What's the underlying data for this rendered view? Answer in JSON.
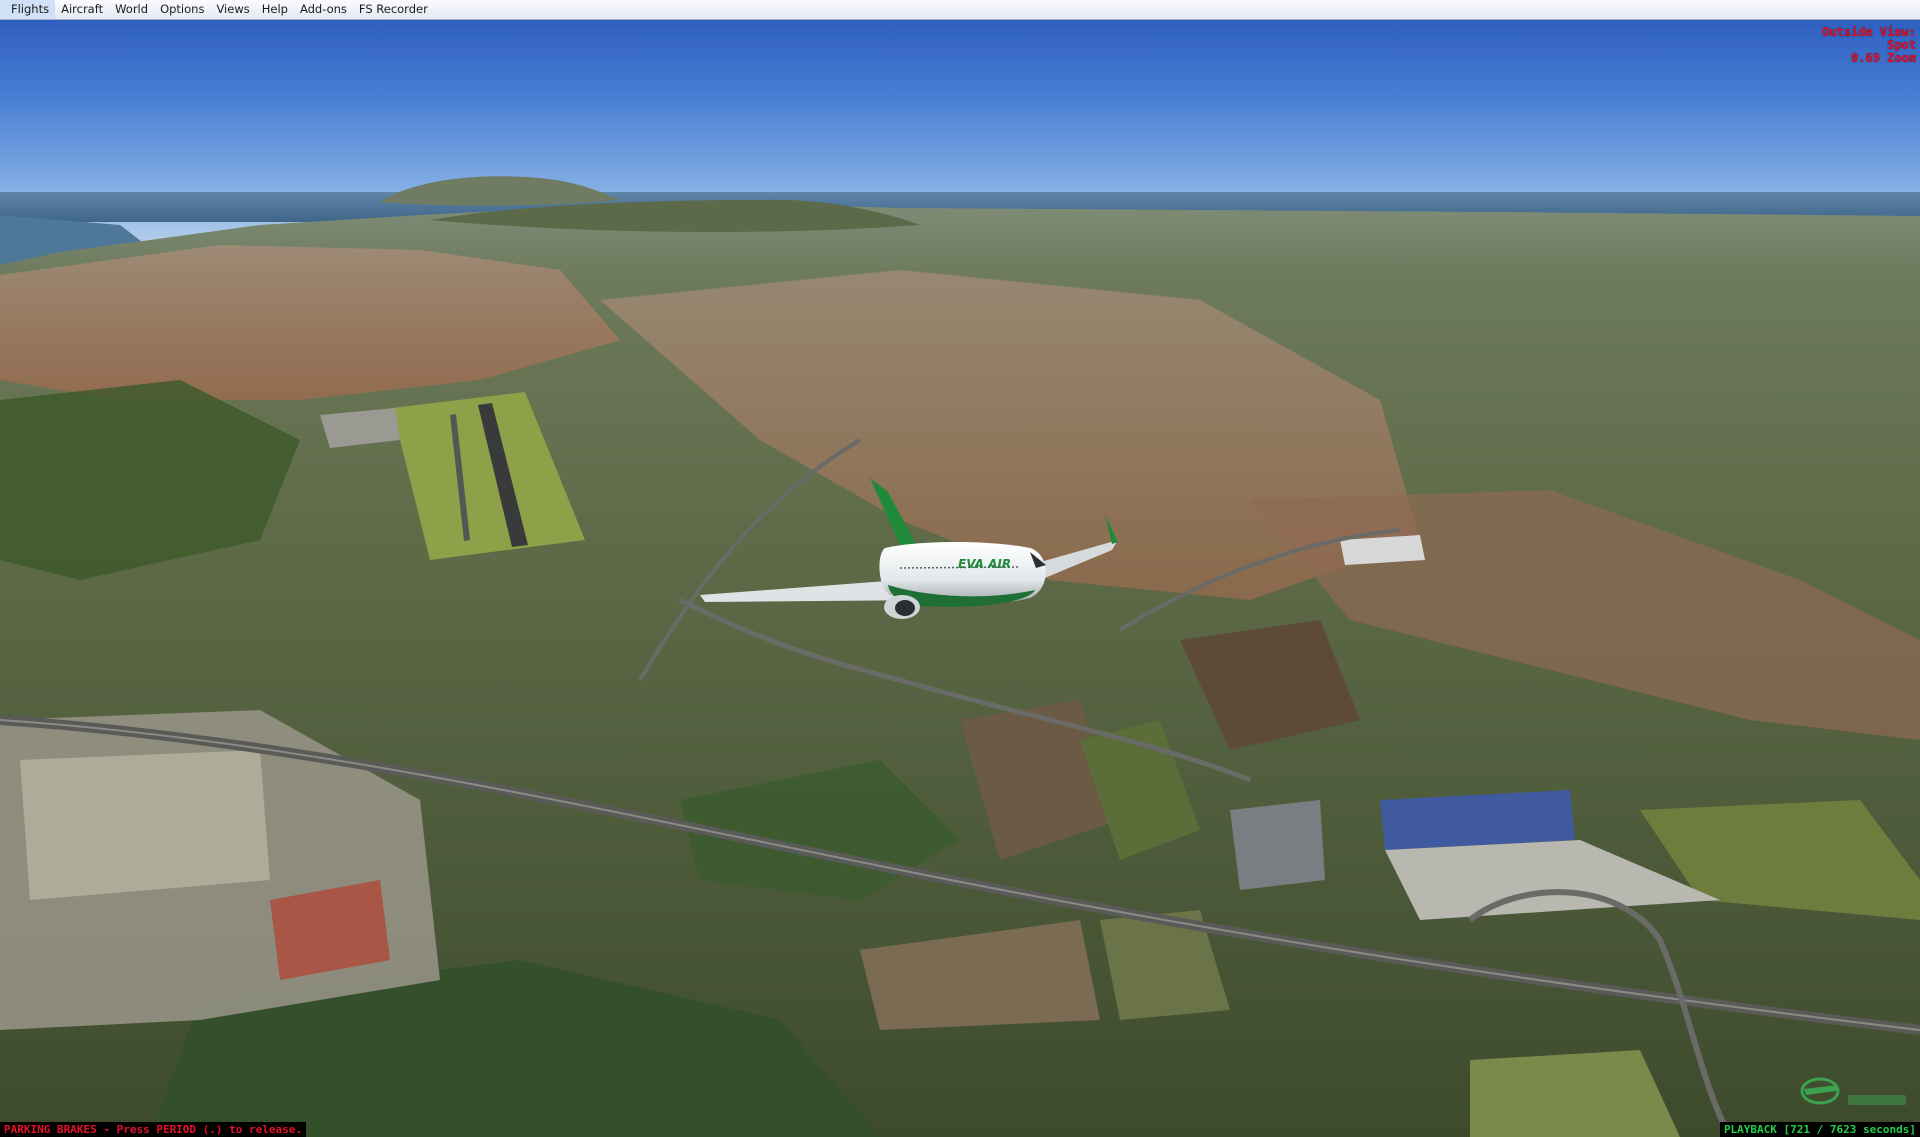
{
  "menu": {
    "items": [
      "Flights",
      "Aircraft",
      "World",
      "Options",
      "Views",
      "Help",
      "Add-ons",
      "FS Recorder"
    ]
  },
  "view_info": {
    "line1": "Outside View:",
    "line2": "Spot",
    "line3": "0.69 Zoom"
  },
  "status": {
    "left": "PARKING BRAKES - Press PERIOD (.) to release.",
    "right": "PLAYBACK [721 / 7623 seconds]"
  },
  "aircraft": {
    "livery_text": "EVA AIR"
  },
  "colors": {
    "hud_red": "#e8102a",
    "hud_green": "#22d04a",
    "livery_green": "#1f8a3a"
  }
}
